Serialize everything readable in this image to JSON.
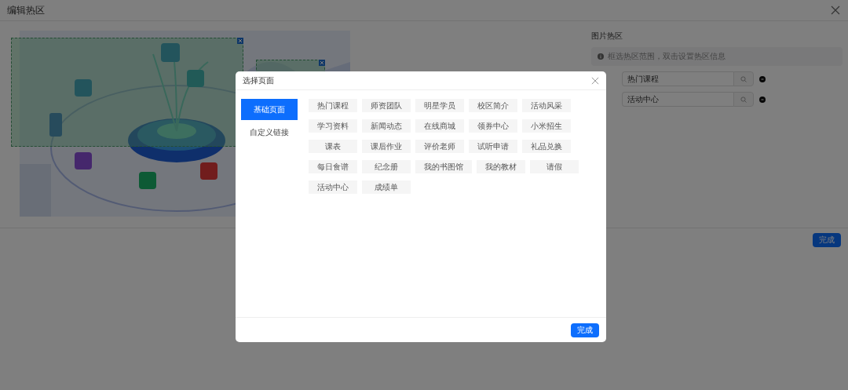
{
  "page": {
    "title": "编辑热区",
    "panel_title": "图片热区",
    "info": "框选热区范围，双击设置热区信息",
    "hotspots": [
      {
        "value": "热门课程"
      },
      {
        "value": "活动中心"
      }
    ],
    "done_button": "完成"
  },
  "dialog": {
    "title": "选择页面",
    "tabs": [
      {
        "label": "基础页面",
        "selected": true
      },
      {
        "label": "自定义链接",
        "selected": false
      }
    ],
    "pages": [
      "热门课程",
      "师资团队",
      "明星学员",
      "校区简介",
      "活动风采",
      "学习资料",
      "新闻动态",
      "在线商城",
      "领券中心",
      "小米招生",
      "课表",
      "课后作业",
      "评价老师",
      "试听申请",
      "礼品兑换",
      "每日食谱",
      "纪念册",
      "我的书图馆",
      "我的教材",
      "请假",
      "活动中心",
      "成绩单"
    ],
    "done_button": "完成"
  }
}
